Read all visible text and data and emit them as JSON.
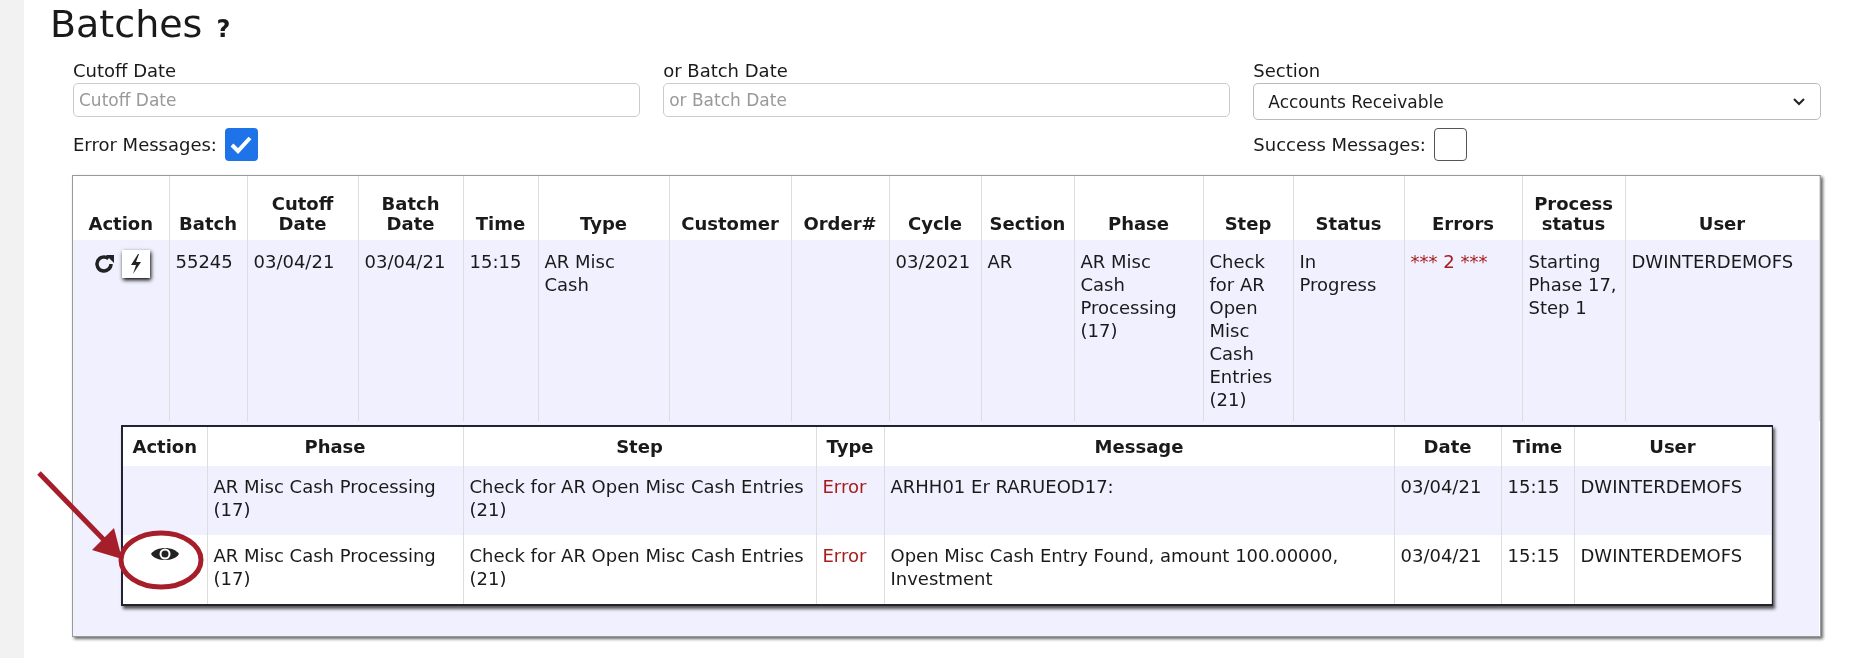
{
  "page": {
    "title": "Batches",
    "help": "?"
  },
  "filters": {
    "cutoff_date": {
      "label": "Cutoff Date",
      "placeholder": "Cutoff Date"
    },
    "batch_date": {
      "label": "or Batch Date",
      "placeholder": "or Batch Date"
    },
    "section": {
      "label": "Section",
      "value": "Accounts Receivable"
    },
    "error_messages": {
      "label": "Error Messages:",
      "checked": true
    },
    "success_messages": {
      "label": "Success Messages:",
      "checked": false
    }
  },
  "batches": {
    "columns": [
      "Action",
      "Batch",
      "Cutoff Date",
      "Batch Date",
      "Time",
      "Type",
      "Customer",
      "Order#",
      "Cycle",
      "Section",
      "Phase",
      "Step",
      "Status",
      "Errors",
      "Process status",
      "User"
    ],
    "rows": [
      {
        "batch": "55245",
        "cutoff_date": "03/04/21",
        "batch_date": "03/04/21",
        "time": "15:15",
        "type": "AR Misc Cash",
        "customer": "",
        "order": "",
        "cycle": "03/2021",
        "section": "AR",
        "phase": "AR Misc Cash Processing (17)",
        "step": "Check for AR Open Misc Cash Entries (21)",
        "status": "In Progress",
        "errors": "*** 2 ***",
        "process_status": "Starting Phase 17, Step 1",
        "user": "DWINTERDEMOFS",
        "expanded": true,
        "messages": {
          "columns": [
            "Action",
            "Phase",
            "Step",
            "Type",
            "Message",
            "Date",
            "Time",
            "User"
          ],
          "rows": [
            {
              "viewable": false,
              "highlighted": false,
              "phase": "AR Misc Cash Processing (17)",
              "step": "Check for AR Open Misc Cash Entries (21)",
              "type": "Error",
              "kind": "error",
              "message": "ARHH01 Er RARUEOD17:",
              "date": "03/04/21",
              "time": "15:15",
              "user": "DWINTERDEMOFS"
            },
            {
              "viewable": true,
              "highlighted": true,
              "phase": "AR Misc Cash Processing (17)",
              "step": "Check for AR Open Misc Cash Entries (21)",
              "type": "Error",
              "kind": "error",
              "message": "Open Misc Cash Entry Found, amount 100.00000, Investment",
              "date": "03/04/21",
              "time": "15:15",
              "user": "DWINTERDEMOFS"
            }
          ]
        }
      }
    ]
  }
}
